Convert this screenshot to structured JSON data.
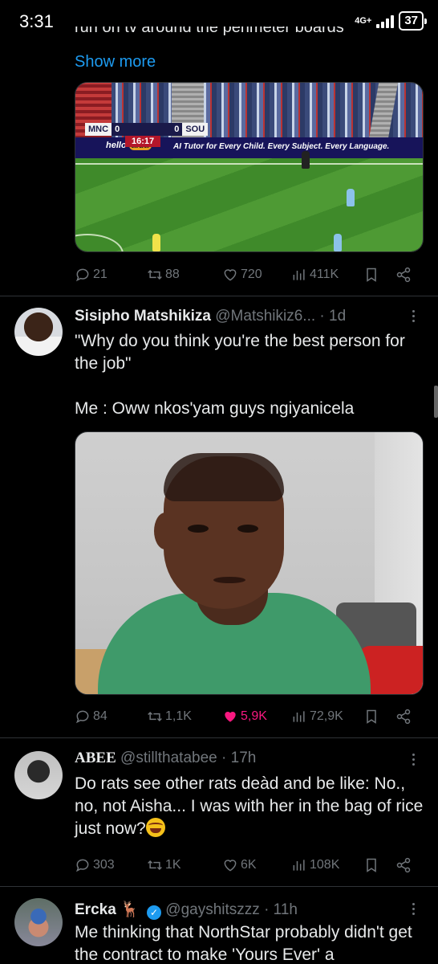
{
  "status_bar": {
    "time": "3:31",
    "network": "4G+",
    "battery": "37"
  },
  "tweet1": {
    "clipped_text": "run on tv around the perimeter boards",
    "show_more": "Show more",
    "image": {
      "score_home": "MNC",
      "score_home_val": "0",
      "score_away": "SOU",
      "score_away_val": "0",
      "clock": "16:17",
      "board_logo_a": "hello",
      "board_logo_b": "aida",
      "board_slogan": "AI Tutor for Every Child. Every Subject. Every Language."
    },
    "actions": {
      "replies": "21",
      "reposts": "88",
      "likes": "720",
      "views": "411K"
    }
  },
  "tweet2": {
    "name": "Sisipho Matshikiza",
    "handle": "@Matshikiz6...",
    "time": "· 1d",
    "text": "\"Why do you think you're the best person for the job\"\n\nMe : Oww nkos'yam guys ngiyanicela",
    "actions": {
      "replies": "84",
      "reposts": "1,1K",
      "likes": "5,9K",
      "views": "72,9K"
    },
    "liked": true
  },
  "tweet3": {
    "name": "ABEE",
    "handle": "@stillthatabee",
    "time": "· 17h",
    "text": "Do rats see other rats deàd and be like: No., no, not Aisha... I was with her in the bag of rice just now?",
    "actions": {
      "replies": "303",
      "reposts": "1K",
      "likes": "6K",
      "views": "108K"
    }
  },
  "tweet4": {
    "name": "Ercka",
    "name_emoji": "🦌",
    "handle": "@gayshitszzz",
    "time": "· 11h",
    "text": "Me thinking that NorthStar probably didn't get the contract to make 'Yours Ever' a"
  },
  "colors": {
    "accent": "#1d9bf0",
    "like": "#f91880",
    "muted": "#71767b"
  }
}
